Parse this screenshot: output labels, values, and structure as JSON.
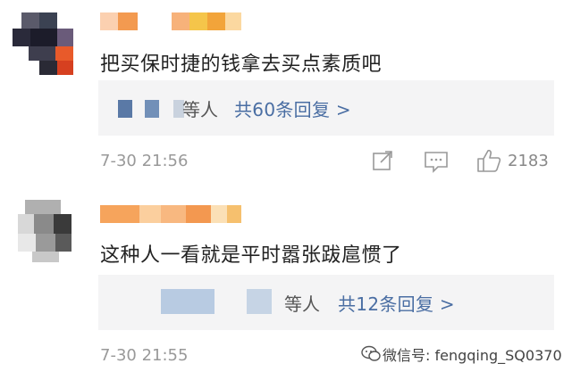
{
  "comments": [
    {
      "text": "把买保时捷的钱拿去买点素质吧",
      "reply_suffix": "等人",
      "reply_link": "共60条回复 >",
      "time": "7-30 21:56",
      "likes": "2183"
    },
    {
      "text": "这种人一看就是平时嚣张跋扈惯了",
      "reply_suffix": "等人",
      "reply_link": "共12条回复 >",
      "time": "7-30 21:55"
    }
  ],
  "watermark": "微信号: fengqing_SQ0370",
  "icons": [
    "share-icon",
    "comment-icon",
    "like-icon",
    "wechat-logo-icon"
  ],
  "colors": {
    "link": "#4a6ea3",
    "muted": "#999999",
    "reply_bg": "#f4f4f5"
  }
}
